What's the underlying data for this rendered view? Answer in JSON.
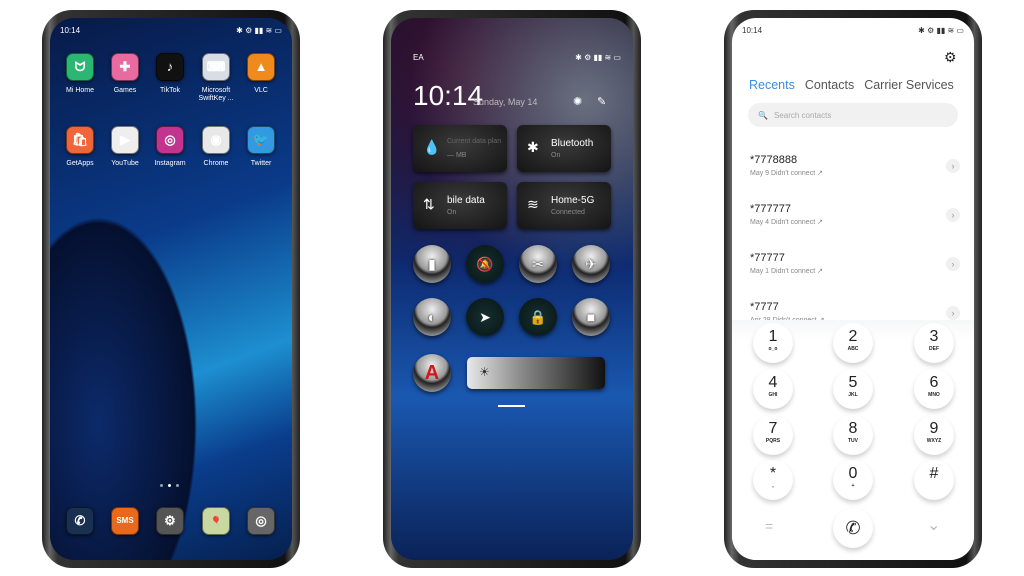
{
  "status": {
    "time": "10:14",
    "carrier_short": "EA",
    "icons": [
      "bluetooth-icon",
      "alarm-icon",
      "signal-icon",
      "wifi-icon",
      "battery-icon"
    ]
  },
  "home": {
    "apps": [
      {
        "label": "Mi Home",
        "icon": "mi-home-icon",
        "color": "#2bb673",
        "glyph": "ᗢ"
      },
      {
        "label": "Games",
        "icon": "games-icon",
        "color": "#e86aa0",
        "glyph": "✚"
      },
      {
        "label": "TikTok",
        "icon": "tiktok-icon",
        "color": "#111111",
        "glyph": "♪"
      },
      {
        "label": "Microsoft SwiftKey ...",
        "icon": "swiftkey-icon",
        "color": "#d8dde6",
        "glyph": "⌨"
      },
      {
        "label": "VLC",
        "icon": "vlc-icon",
        "color": "#f08a1c",
        "glyph": "▲"
      },
      {
        "label": "GetApps",
        "icon": "getapps-icon",
        "color": "#f0663a",
        "glyph": "🛍"
      },
      {
        "label": "YouTube",
        "icon": "youtube-icon",
        "color": "#eeeeee",
        "glyph": "▶"
      },
      {
        "label": "Instagram",
        "icon": "instagram-icon",
        "color": "#c1358f",
        "glyph": "◎"
      },
      {
        "label": "Chrome",
        "icon": "chrome-icon",
        "color": "#e8e8e8",
        "glyph": "◉"
      },
      {
        "label": "Twitter",
        "icon": "twitter-icon",
        "color": "#3399e0",
        "glyph": "🐦"
      }
    ],
    "dock": [
      {
        "icon": "phone-icon",
        "color": "#1a3050",
        "glyph": "✆"
      },
      {
        "icon": "sms-icon",
        "color": "#e8681c",
        "glyph": "SMS"
      },
      {
        "icon": "settings-icon",
        "color": "#555555",
        "glyph": "⚙"
      },
      {
        "icon": "gallery-icon",
        "color": "#c8d8a0",
        "glyph": "🎈"
      },
      {
        "icon": "camera-icon",
        "color": "#666666",
        "glyph": "◎"
      }
    ],
    "page_indicator": {
      "pages": 3,
      "current": 2
    }
  },
  "control_center": {
    "time": "10:14",
    "date": "Sunday, May 14",
    "tiles": [
      {
        "title": "Current data plan",
        "sub": "— MB",
        "icon": "data-usage-icon",
        "glyph": "💧"
      },
      {
        "title": "Bluetooth",
        "sub": "On",
        "icon": "bluetooth-icon",
        "glyph": "✱"
      },
      {
        "title": "bile data",
        "sub": "On",
        "icon": "mobile-data-icon",
        "glyph": "⇅"
      },
      {
        "title": "Home-5G",
        "sub": "Connected",
        "icon": "wifi-icon",
        "glyph": "≋"
      }
    ],
    "toggles": [
      {
        "icon": "flashlight-icon",
        "glyph": "▮",
        "on": true
      },
      {
        "icon": "silent-icon",
        "glyph": "🔕",
        "on": false
      },
      {
        "icon": "screenshot-icon",
        "glyph": "✂",
        "on": true
      },
      {
        "icon": "airplane-icon",
        "glyph": "✈",
        "on": true
      },
      {
        "icon": "dark-mode-icon",
        "glyph": "◐",
        "on": true
      },
      {
        "icon": "location-icon",
        "glyph": "➤",
        "on": false
      },
      {
        "icon": "rotation-lock-icon",
        "glyph": "🔒",
        "on": false
      },
      {
        "icon": "screen-record-icon",
        "glyph": "■",
        "on": true
      }
    ],
    "font_button": "A",
    "brightness": 0.1
  },
  "dialer": {
    "tabs": [
      "Recents",
      "Contacts",
      "Carrier Services"
    ],
    "active_tab": "Recents",
    "accent": "#3a8ee0",
    "search_placeholder": "Search contacts",
    "calls": [
      {
        "number": "*7778888",
        "detail": "May 9 Didn't connect ↗"
      },
      {
        "number": "*777777",
        "detail": "May 4 Didn't connect ↗"
      },
      {
        "number": "*77777",
        "detail": "May 1 Didn't connect ↗"
      },
      {
        "number": "*7777",
        "detail": "Apr 28 Didn't connect ↗"
      }
    ],
    "keys": [
      {
        "k": "1",
        "l": "o_o"
      },
      {
        "k": "2",
        "l": "ABC"
      },
      {
        "k": "3",
        "l": "DEF"
      },
      {
        "k": "4",
        "l": "GHI"
      },
      {
        "k": "5",
        "l": "JKL"
      },
      {
        "k": "6",
        "l": "MNO"
      },
      {
        "k": "7",
        "l": "PQRS"
      },
      {
        "k": "8",
        "l": "TUV"
      },
      {
        "k": "9",
        "l": "WXYZ"
      },
      {
        "k": "*",
        "l": ","
      },
      {
        "k": "0",
        "l": "+"
      },
      {
        "k": "#",
        "l": ""
      }
    ],
    "bottom": {
      "menu": "=",
      "call": "✆",
      "collapse": "⌄"
    }
  }
}
